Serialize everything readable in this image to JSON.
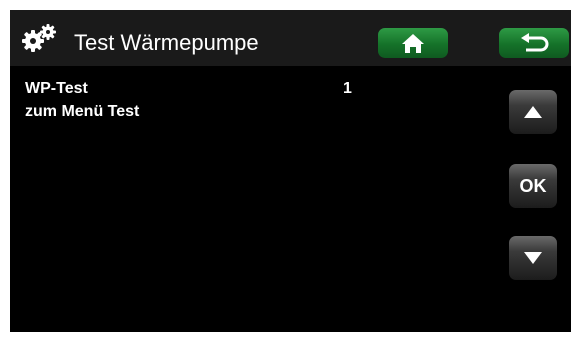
{
  "header": {
    "title": "Test Wärmepumpe",
    "icon": "gears-icon",
    "home_icon": "home-icon",
    "back_icon": "back-arrow-icon"
  },
  "rows": [
    {
      "label": "WP-Test",
      "value": "1"
    },
    {
      "label": "zum Menü Test",
      "value": ""
    }
  ],
  "side_buttons": {
    "up_icon": "arrow-up-icon",
    "ok_label": "OK",
    "down_icon": "arrow-down-icon"
  },
  "colors": {
    "background": "#000000",
    "header": "#1a1a1a",
    "accent_green": "#157229",
    "button_gray": "#3a3a3a",
    "text": "#ffffff"
  }
}
